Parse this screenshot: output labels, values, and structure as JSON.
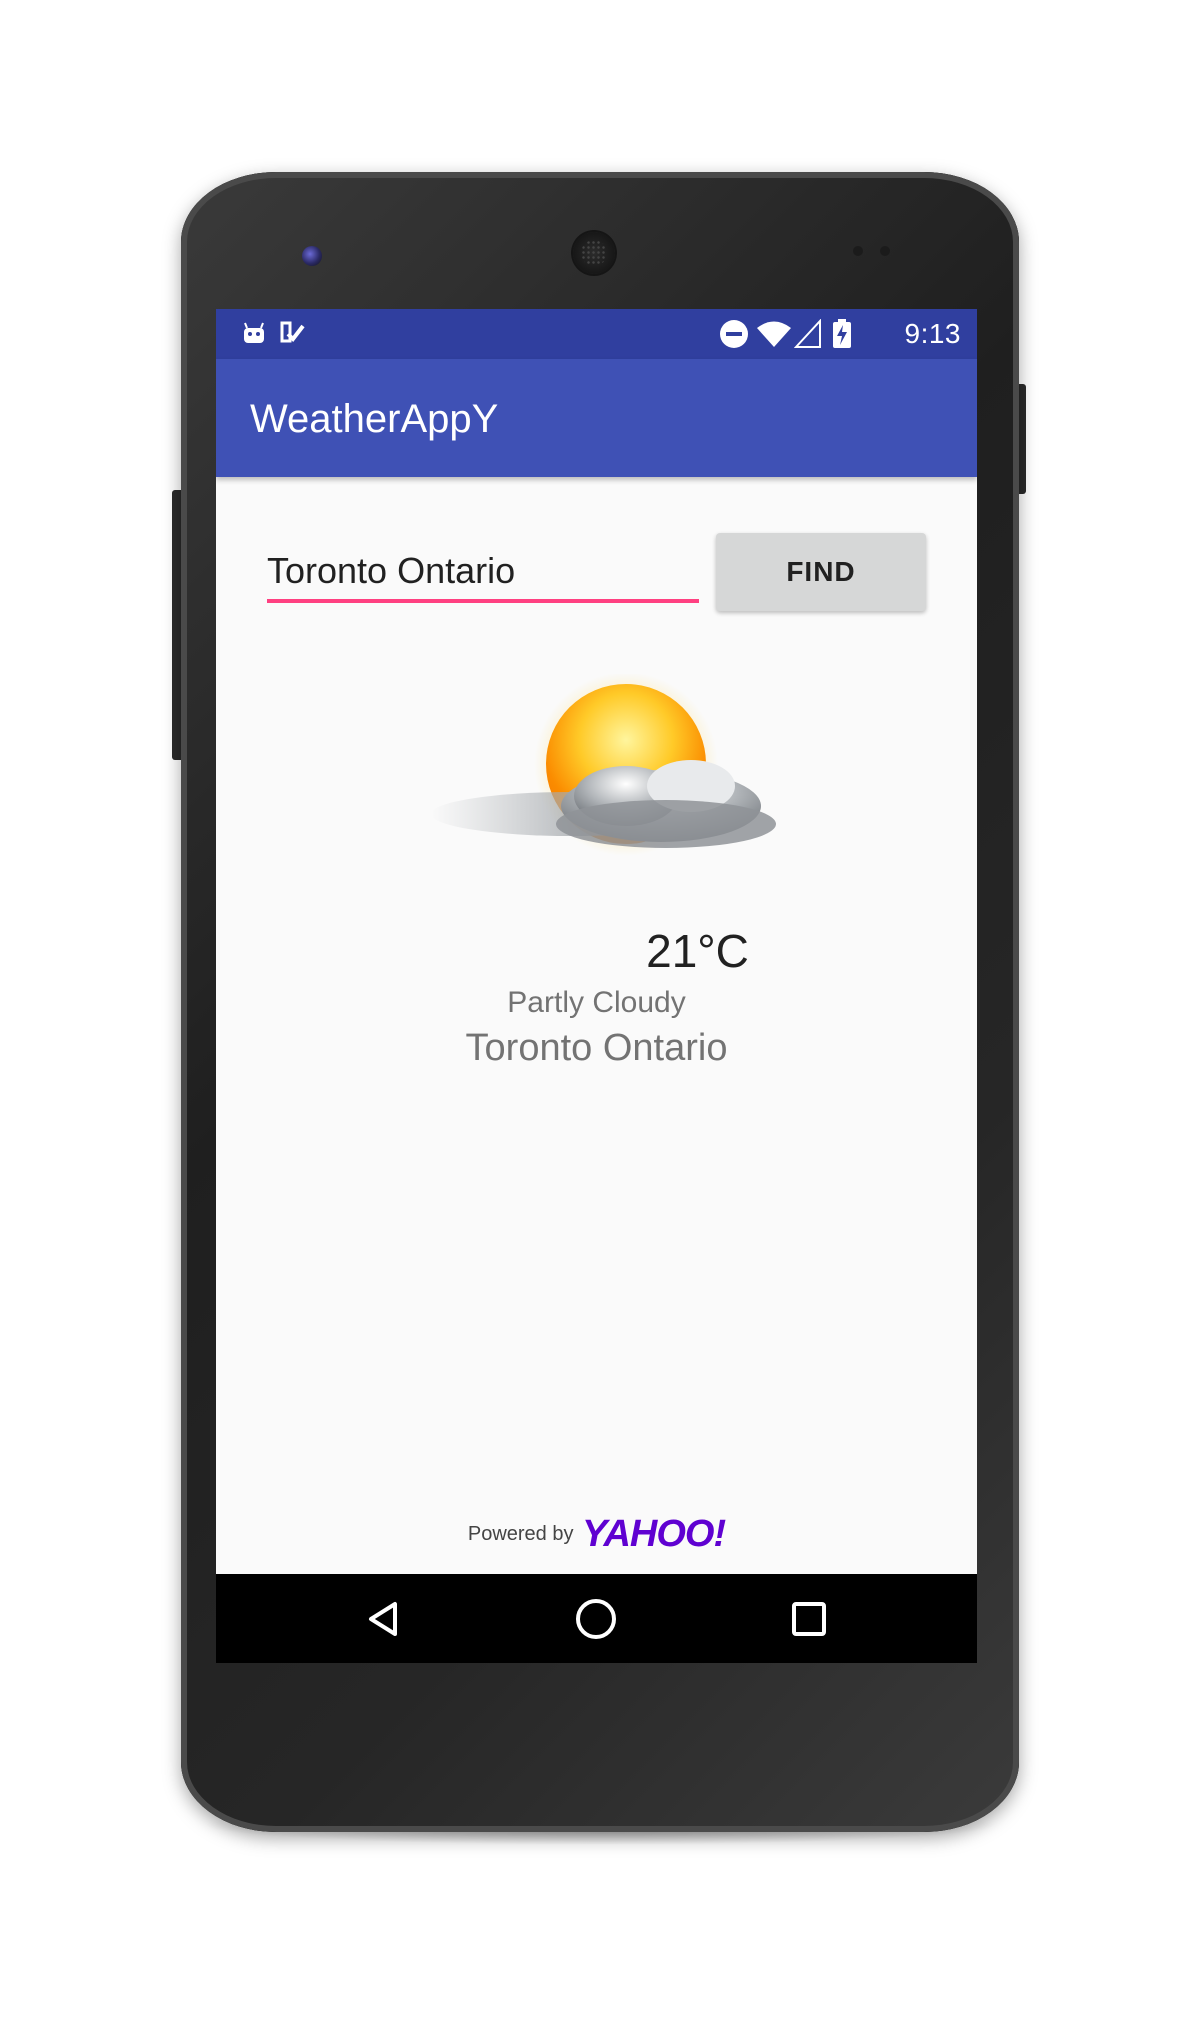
{
  "status_bar": {
    "time": "9:13",
    "icons": [
      "android-icon",
      "check-notification-icon",
      "do-not-disturb-icon",
      "wifi-icon",
      "cell-signal-icon",
      "battery-charging-icon"
    ]
  },
  "app_bar": {
    "title": "WeatherAppY"
  },
  "search": {
    "value": "Toronto Ontario",
    "button_label": "FIND"
  },
  "weather": {
    "icon": "partly-cloudy-icon",
    "temperature": "21°C",
    "condition": "Partly Cloudy",
    "location": "Toronto Ontario"
  },
  "footer": {
    "powered_by": "Powered by",
    "brand": "YAHOO!"
  },
  "nav_bar": {
    "icons": [
      "back-icon",
      "home-icon",
      "recents-icon"
    ]
  },
  "colors": {
    "status_bar": "#303f9f",
    "app_bar": "#3f51b5",
    "accent": "#ff4081",
    "yahoo": "#5f01d1"
  }
}
